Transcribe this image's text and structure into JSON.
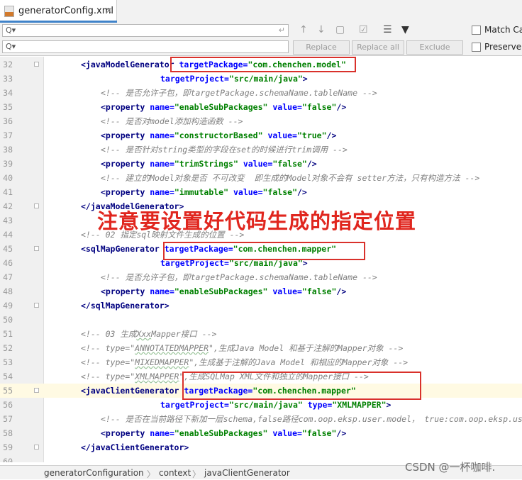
{
  "tab": {
    "title": "generatorConfig.xml",
    "close": "×",
    "icon": "xml-file-icon"
  },
  "find": {
    "search_icon": "Q▾",
    "enter_icon": "↵",
    "buttons": {
      "replace": "Replace",
      "replace_all": "Replace all",
      "exclude": "Exclude"
    },
    "options": {
      "match_case": "Match Case",
      "preserve_case": "Preserve Case"
    }
  },
  "code_lines": [
    {
      "num": "32",
      "indent": 8,
      "html": "<span class=\"tag\">&lt;javaModelGenerator</span> <span class=\"attr\">targetPackage=</span><span class=\"val\">\"com.chenchen.model\"</span>"
    },
    {
      "num": "33",
      "indent": 24,
      "html": "<span class=\"attr\">targetProject=</span><span class=\"val\">\"src/main/java\"</span><span class=\"tag\">&gt;</span>"
    },
    {
      "num": "34",
      "indent": 12,
      "html": "<span class=\"cmt\">&lt;!-- 是否允许子包，即targetPackage.schemaName.tableName --&gt;</span>"
    },
    {
      "num": "35",
      "indent": 12,
      "html": "<span class=\"tag\">&lt;property</span> <span class=\"attr\">name=</span><span class=\"val\">\"enableSubPackages\"</span> <span class=\"attr\">value=</span><span class=\"val\">\"false\"</span><span class=\"tag\">/&gt;</span>"
    },
    {
      "num": "36",
      "indent": 12,
      "html": "<span class=\"cmt\">&lt;!-- 是否对model添加构造函数 --&gt;</span>"
    },
    {
      "num": "37",
      "indent": 12,
      "html": "<span class=\"tag\">&lt;property</span> <span class=\"attr\">name=</span><span class=\"val\">\"constructorBased\"</span> <span class=\"attr\">value=</span><span class=\"val\">\"true\"</span><span class=\"tag\">/&gt;</span>"
    },
    {
      "num": "38",
      "indent": 12,
      "html": "<span class=\"cmt\">&lt;!-- 是否针对string类型的字段在set的时候进行trim调用 --&gt;</span>"
    },
    {
      "num": "39",
      "indent": 12,
      "html": "<span class=\"tag\">&lt;property</span> <span class=\"attr\">name=</span><span class=\"val\">\"trimStrings\"</span> <span class=\"attr\">value=</span><span class=\"val\">\"false\"</span><span class=\"tag\">/&gt;</span>"
    },
    {
      "num": "40",
      "indent": 12,
      "html": "<span class=\"cmt\">&lt;!-- 建立的Model对象是否 不可改变  即生成的Model对象不会有 setter方法，只有构造方法 --&gt;</span>"
    },
    {
      "num": "41",
      "indent": 12,
      "html": "<span class=\"tag\">&lt;property</span> <span class=\"attr\">name=</span><span class=\"val\">\"immutable\"</span> <span class=\"attr\">value=</span><span class=\"val\">\"false\"</span><span class=\"tag\">/&gt;</span>"
    },
    {
      "num": "42",
      "indent": 8,
      "html": "<span class=\"tag\">&lt;/javaModelGenerator&gt;</span>"
    },
    {
      "num": "43",
      "indent": 8,
      "html": ""
    },
    {
      "num": "44",
      "indent": 8,
      "html": "<span class=\"cmt\">&lt;!-- 02 指定sql映射文件生成的位置 --&gt;</span>"
    },
    {
      "num": "45",
      "indent": 8,
      "html": "<span class=\"tag\">&lt;sqlMapGenerator</span> <span class=\"attr\">targetPackage=</span><span class=\"val\">\"com.chenchen.mapper\"</span>"
    },
    {
      "num": "46",
      "indent": 24,
      "html": "<span class=\"attr\">targetProject=</span><span class=\"val\">\"src/main/java\"</span><span class=\"tag\">&gt;</span>"
    },
    {
      "num": "47",
      "indent": 12,
      "html": "<span class=\"cmt\">&lt;!-- 是否允许子包，即targetPackage.schemaName.tableName --&gt;</span>"
    },
    {
      "num": "48",
      "indent": 12,
      "html": "<span class=\"tag\">&lt;property</span> <span class=\"attr\">name=</span><span class=\"val\">\"enableSubPackages\"</span> <span class=\"attr\">value=</span><span class=\"val\">\"false\"</span><span class=\"tag\">/&gt;</span>"
    },
    {
      "num": "49",
      "indent": 8,
      "html": "<span class=\"tag\">&lt;/sqlMapGenerator&gt;</span>"
    },
    {
      "num": "50",
      "indent": 8,
      "html": ""
    },
    {
      "num": "51",
      "indent": 8,
      "html": "<span class=\"cmt\">&lt;!-- 03 生成<span class=\"sq\">Xxx</span>Mapper接口 --&gt;</span>"
    },
    {
      "num": "52",
      "indent": 8,
      "html": "<span class=\"cmt\">&lt;!-- type=\"<span class=\"sq\">ANNOTATEDMAPPER</span>\",生成Java Model 和基于注解的Mapper对象 --&gt;</span>"
    },
    {
      "num": "53",
      "indent": 8,
      "html": "<span class=\"cmt\">&lt;!-- type=\"<span class=\"sq\">MIXEDMAPPER</span>\",生成基于注解的Java Model 和相应的Mapper对象 --&gt;</span>"
    },
    {
      "num": "54",
      "indent": 8,
      "html": "<span class=\"cmt\">&lt;!-- type=\"<span class=\"sq\">XMLMAPPER</span>\",生成SQLMap XML文件和独立的Mapper接口 --&gt;</span>"
    },
    {
      "num": "55",
      "indent": 8,
      "current": true,
      "html": "<span class=\"tag\">&lt;javaClientGenerator</span> <span class=\"attr\">targetPackage=</span><span class=\"val\">\"com.chenchen.mapper\"</span>"
    },
    {
      "num": "56",
      "indent": 24,
      "html": "<span class=\"attr\">targetProject=</span><span class=\"val\">\"src/main/java\"</span> <span class=\"attr\">type=</span><span class=\"val\">\"XMLMAPPER\"</span><span class=\"tag\">&gt;</span>"
    },
    {
      "num": "57",
      "indent": 12,
      "html": "<span class=\"cmt\">&lt;!-- 是否在当前路径下新加一层schema,false路径com.oop.eksp.user.model， true:com.oop.eksp.user.model.[schemaName] --&gt;</span>"
    },
    {
      "num": "58",
      "indent": 12,
      "html": "<span class=\"tag\">&lt;property</span> <span class=\"attr\">name=</span><span class=\"val\">\"enableSubPackages\"</span> <span class=\"attr\">value=</span><span class=\"val\">\"false\"</span><span class=\"tag\">/&gt;</span>"
    },
    {
      "num": "59",
      "indent": 8,
      "html": "<span class=\"tag\">&lt;/javaClientGenerator&gt;</span>"
    },
    {
      "num": "60",
      "indent": 8,
      "html": ""
    }
  ],
  "annotation": "注意要设置好代码生成的指定位置",
  "breadcrumb": [
    "generatorConfiguration",
    "context",
    "javaClientGenerator"
  ],
  "breadcrumb_sep": "〉",
  "watermark": "CSDN @一杯咖啡.",
  "colors": {
    "annotation_red": "#e0261e",
    "box_red": "#d9312b",
    "tag": "#000080",
    "attribute": "#0000ff",
    "value": "#008000",
    "comment": "#808080"
  }
}
